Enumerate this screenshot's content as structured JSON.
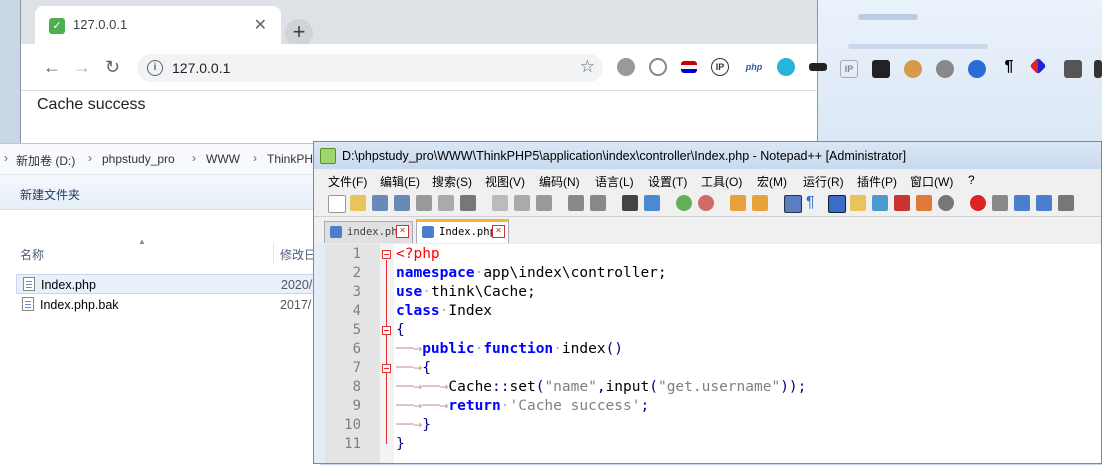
{
  "browser": {
    "tab_title": "127.0.0.1",
    "tab_favicon": "leaf-icon",
    "url": "127.0.0.1",
    "page_text": "Cache success",
    "extensions": [
      "IP",
      "php",
      "IP",
      "¶"
    ]
  },
  "explorer": {
    "breadcrumb": [
      "新加卷 (D:)",
      "phpstudy_pro",
      "WWW",
      "ThinkPH"
    ],
    "new_folder": "新建文件夹",
    "columns": {
      "name": "名称",
      "date": "修改日"
    },
    "files": [
      {
        "name": "Index.php",
        "date": "2020/"
      },
      {
        "name": "Index.php.bak",
        "date": "2017/"
      }
    ]
  },
  "notepad": {
    "title": "D:\\phpstudy_pro\\WWW\\ThinkPHP5\\application\\index\\controller\\Index.php - Notepad++ [Administrator]",
    "menu": [
      "文件(F)",
      "编辑(E)",
      "搜索(S)",
      "视图(V)",
      "编码(N)",
      "语言(L)",
      "设置(T)",
      "工具(O)",
      "宏(M)",
      "运行(R)",
      "插件(P)",
      "窗口(W)",
      "?"
    ],
    "tabs": [
      {
        "label": "index.php",
        "active": false
      },
      {
        "label": "Index.php",
        "active": true
      }
    ],
    "line_numbers": [
      "1",
      "2",
      "3",
      "4",
      "5",
      "6",
      "7",
      "8",
      "9",
      "10",
      "11"
    ],
    "code": {
      "l1": "<?php",
      "l2_kw": "namespace",
      "l2_rest": "app\\index\\controller;",
      "l3_kw": "use",
      "l3_rest": "think\\Cache;",
      "l4_kw": "class",
      "l4_rest": "Index",
      "l5": "{",
      "l6_kw1": "public",
      "l6_kw2": "function",
      "l6_rest": "index",
      "l6_paren": "()",
      "l7": "{",
      "l8_a": "Cache",
      "l8_b": "::",
      "l8_c": "set",
      "l8_d": "(",
      "l8_e": "\"name\"",
      "l8_f": ",",
      "l8_g": "input",
      "l8_h": "(",
      "l8_i": "\"get.username\"",
      "l8_j": "));",
      "l9_kw": "return",
      "l9_str": "'Cache success'",
      "l9_end": ";",
      "l10": "}",
      "l11": "}"
    }
  }
}
